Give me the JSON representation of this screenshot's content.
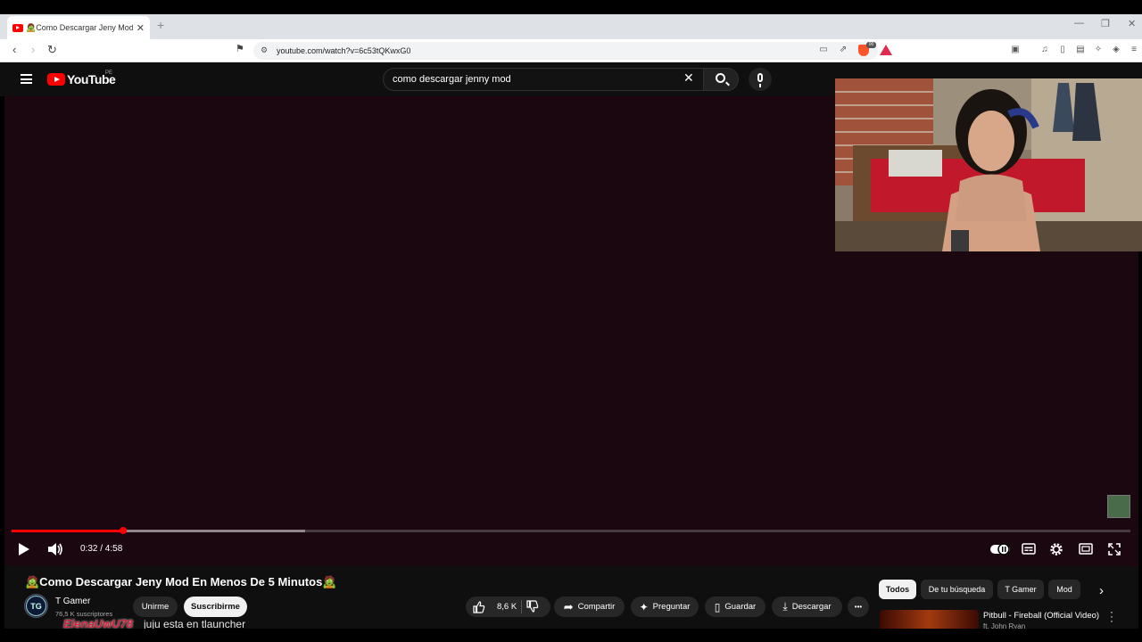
{
  "browser": {
    "tab_title": "🧟Como Descargar Jeny Mod En Menos De 5 Minutos🧟",
    "new_tab_label": "+",
    "url": "youtube.com/watch?v=6c53tQKwxG0",
    "brave_badge": "00"
  },
  "youtube": {
    "logo_text": "YouTube",
    "country": "PE",
    "search_value": "como descargar jenny mod",
    "search_clear": "✕"
  },
  "player": {
    "time": "0:32 / 4:58",
    "progress_played": 0.1,
    "progress_buffered": 0.262
  },
  "video": {
    "title": "🧟Como Descargar Jeny Mod En Menos De 5 Minutos🧟",
    "channel": "T Gamer",
    "subscribers": "76,5 K suscriptores",
    "join_label": "Unirme",
    "subscribe_label": "Suscribirme",
    "likes": "8,6 K",
    "share_label": "Compartir",
    "ask_label": "Preguntar",
    "save_label": "Guardar",
    "download_label": "Descargar",
    "more_label": "•••"
  },
  "chips": [
    "Todos",
    "De tu búsqueda",
    "T Gamer",
    "Mod"
  ],
  "recommendation": {
    "title": "Pitbull - Fireball (Official Video)",
    "subtitle": "ft. John Ryan"
  },
  "overlay_chat": {
    "user": "ElenaUwU78",
    "message": "juju esta en tlauncher"
  },
  "colors": {
    "youtube_red": "#ff0000",
    "video_bg": "#1b0710",
    "page_bg": "#0f0f0f"
  }
}
